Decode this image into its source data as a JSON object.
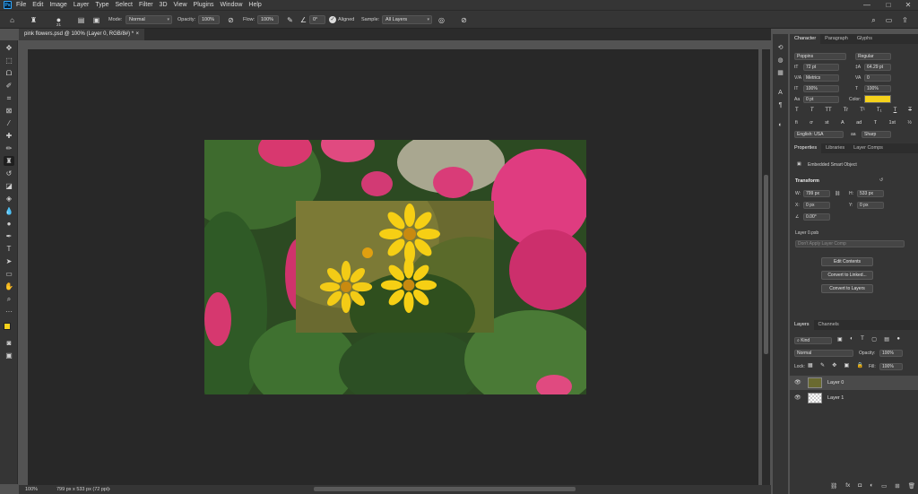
{
  "menubar": {
    "logo": "Ps",
    "items": [
      "File",
      "Edit",
      "Image",
      "Layer",
      "Type",
      "Select",
      "Filter",
      "3D",
      "View",
      "Plugins",
      "Window",
      "Help"
    ]
  },
  "options": {
    "brush_size": "21",
    "mode_label": "Mode:",
    "mode_value": "Normal",
    "opacity_label": "Opacity:",
    "opacity_value": "100%",
    "flow_label": "Flow:",
    "flow_value": "100%",
    "angle_value": "0°",
    "aligned_label": "Aligned",
    "sample_label": "Sample:",
    "sample_value": "All Layers"
  },
  "document": {
    "tab_title": "pink flowers.psd @ 100% (Layer 0, RGB/8#) *"
  },
  "status": {
    "zoom": "100%",
    "info": "799 px x 533 px (72 ppi)"
  },
  "character": {
    "tabs": [
      "Character",
      "Paragraph",
      "Glyphs"
    ],
    "font": "Poppins",
    "style": "Regular",
    "size": "72 pt",
    "leading": "64.29 pt",
    "kerning": "Metrics",
    "tracking": "0",
    "vscale": "100%",
    "hscale": "100%",
    "baseline": "0 pt",
    "color_label": "Color:",
    "color": "#f5d21c",
    "type_buttons": [
      "T",
      "T",
      "TT",
      "Tr",
      "T¹",
      "T₁",
      "T",
      "T"
    ],
    "opentype_buttons": [
      "fi",
      "ơ",
      "st",
      "A",
      "ad",
      "T",
      "1st",
      "½"
    ],
    "language": "English: USA",
    "antialias": "Sharp"
  },
  "properties": {
    "tabs": [
      "Properties",
      "Libraries",
      "Layer Comps"
    ],
    "object_type": "Embedded Smart Object",
    "transform_label": "Transform",
    "w": "799 px",
    "h": "533 px",
    "x": "0 px",
    "y": "0 px",
    "angle": "0.00°",
    "file_name": "Layer 0.psb",
    "comp_placeholder": "Don't Apply Layer Comp",
    "buttons": [
      "Edit Contents",
      "Convert to Linked...",
      "Convert to Layers"
    ]
  },
  "layers_panel": {
    "tabs": [
      "Layers",
      "Channels"
    ],
    "filter": "Kind",
    "blend_mode": "Normal",
    "opacity_label": "Opacity:",
    "opacity": "100%",
    "lock_label": "Lock:",
    "fill_label": "Fill:",
    "fill": "100%",
    "layers": [
      {
        "name": "Layer 0",
        "selected": true
      },
      {
        "name": "Layer 1",
        "selected": false
      }
    ]
  }
}
